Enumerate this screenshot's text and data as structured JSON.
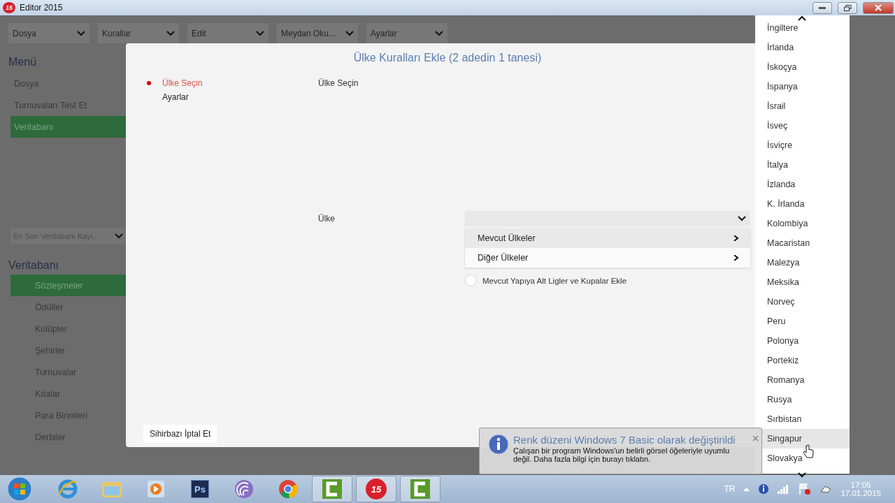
{
  "window": {
    "title": "Editor 2015",
    "logo": "15"
  },
  "menubar": [
    {
      "label": "Dosya"
    },
    {
      "label": "Kurallar"
    },
    {
      "label": "Edit"
    },
    {
      "label": "Meydan Oku..."
    },
    {
      "label": "Ayarlar"
    }
  ],
  "sidebar": {
    "menu_heading": "Menü",
    "menu_items": [
      {
        "label": "Dosya",
        "selected": false
      },
      {
        "label": "Turnuvaları Test Et",
        "selected": false
      },
      {
        "label": "Veritabanı",
        "selected": true
      }
    ],
    "recent_select": "En Son Veritabanı Kayı...",
    "db_heading": "Veritabanı",
    "db_items": [
      {
        "label": "Sözleşmeler",
        "selected": true
      },
      {
        "label": "Ödüller",
        "selected": false
      },
      {
        "label": "Kulüpler",
        "selected": false
      },
      {
        "label": "Şehirler",
        "selected": false
      },
      {
        "label": "Turnuvalar",
        "selected": false
      },
      {
        "label": "Kıtalar",
        "selected": false
      },
      {
        "label": "Para Birimleri",
        "selected": false
      },
      {
        "label": "Derbiler",
        "selected": false
      }
    ]
  },
  "dialog": {
    "title": "Ülke Kuralları Ekle (2 adedin 1 tanesi)",
    "steps": [
      {
        "label": "Ülke Seçin",
        "selected": true
      },
      {
        "label": "Ayarlar",
        "selected": false
      }
    ],
    "page_heading": "Ülke Seçin",
    "country_label": "Ülke",
    "submenu": [
      {
        "label": "Mevcut Ülkeler",
        "selected": true
      },
      {
        "label": "Diğer Ülkeler",
        "selected": false
      }
    ],
    "option": {
      "label": "Mevcut Yapıya Alt Ligler ve Kupalar Ekle",
      "checked": false
    },
    "cancel_button": "Sihirbazı İptal Et"
  },
  "country_list": {
    "items": [
      {
        "label": "İngiltere",
        "selected": false
      },
      {
        "label": "İrlanda",
        "selected": false
      },
      {
        "label": "İskoçya",
        "selected": false
      },
      {
        "label": "İspanya",
        "selected": false
      },
      {
        "label": "İsrail",
        "selected": false
      },
      {
        "label": "İsveç",
        "selected": false
      },
      {
        "label": "İsviçre",
        "selected": false
      },
      {
        "label": "İtalya",
        "selected": false
      },
      {
        "label": "İzlanda",
        "selected": false
      },
      {
        "label": "K. İrlanda",
        "selected": false
      },
      {
        "label": "Kolombiya",
        "selected": false
      },
      {
        "label": "Macaristan",
        "selected": false
      },
      {
        "label": "Malezya",
        "selected": false
      },
      {
        "label": "Meksika",
        "selected": false
      },
      {
        "label": "Norveç",
        "selected": false
      },
      {
        "label": "Peru",
        "selected": false
      },
      {
        "label": "Polonya",
        "selected": false
      },
      {
        "label": "Portekiz",
        "selected": false
      },
      {
        "label": "Romanya",
        "selected": false
      },
      {
        "label": "Rusya",
        "selected": false
      },
      {
        "label": "Sırbistan",
        "selected": false
      },
      {
        "label": "Singapur",
        "selected": true
      },
      {
        "label": "Slovakya",
        "selected": false
      }
    ]
  },
  "balloon": {
    "title": "Renk düzeni Windows 7 Basic olarak değiştirildi",
    "body": "Çalışan bir program Windows'un belirli görsel öğeleriyle uyumlu değil.  Daha fazla bilgi için burayı tıklatın."
  },
  "taskbar": {
    "apps": [
      {
        "kind": "ie",
        "active": false
      },
      {
        "kind": "folder",
        "active": false
      },
      {
        "kind": "media",
        "active": false
      },
      {
        "kind": "ps",
        "label": "Ps",
        "active": false
      },
      {
        "kind": "torrent",
        "active": false
      },
      {
        "kind": "chrome",
        "active": false
      },
      {
        "kind": "camtasia",
        "active": true
      },
      {
        "kind": "editor",
        "label": "15",
        "active": true
      },
      {
        "kind": "camtasia",
        "active": true
      }
    ],
    "tray": {
      "language": "TR",
      "time": "17:05",
      "date": "17.01.2015"
    }
  }
}
